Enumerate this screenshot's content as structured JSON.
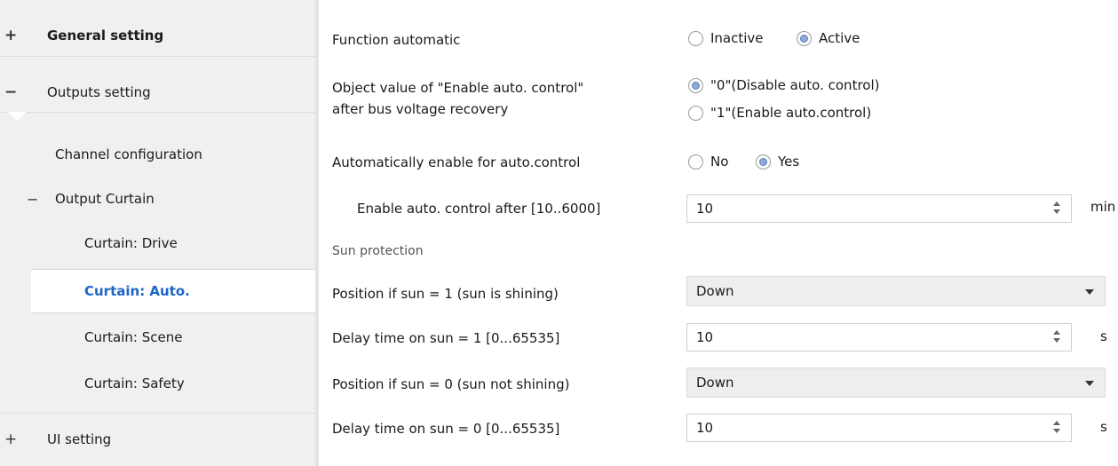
{
  "sidebar": {
    "general_setting": {
      "symbol": "+",
      "label": "General setting"
    },
    "outputs_setting": {
      "symbol": "−",
      "label": "Outputs setting"
    },
    "channel_configuration": {
      "label": "Channel configuration"
    },
    "output_curtain": {
      "symbol": "−",
      "label": "Output Curtain"
    },
    "curtain_drive": {
      "label": "Curtain: Drive"
    },
    "curtain_auto": {
      "label": "Curtain: Auto."
    },
    "curtain_scene": {
      "label": "Curtain: Scene"
    },
    "curtain_safety": {
      "label": "Curtain: Safety"
    },
    "ui_setting": {
      "symbol": "+",
      "label": "UI setting"
    }
  },
  "main": {
    "function_automatic": {
      "label": "Function automatic",
      "options": [
        "Inactive",
        "Active"
      ],
      "selected": "Active"
    },
    "enable_auto_control_value": {
      "label_line1": "Object value of \"Enable auto. control\"",
      "label_line2": "after bus voltage recovery",
      "options": [
        "\"0\"(Disable auto. control)",
        "\"1\"(Enable auto.control)"
      ],
      "selected": "\"0\"(Disable auto. control)"
    },
    "auto_enable": {
      "label": "Automatically enable for auto.control",
      "options": [
        "No",
        "Yes"
      ],
      "selected": "Yes"
    },
    "enable_after": {
      "label": "Enable auto. control after [10..6000]",
      "value": "10",
      "unit": "min"
    },
    "sun_protection": {
      "label": "Sun protection"
    },
    "position_sun_1": {
      "label": "Position if sun = 1  (sun is shining)",
      "value": "Down"
    },
    "delay_sun_1": {
      "label": "Delay time on sun = 1  [0...65535]",
      "value": "10",
      "unit": "s"
    },
    "position_sun_0": {
      "label": "Position if sun = 0  (sun not shining)",
      "value": "Down"
    },
    "delay_sun_0": {
      "label": "Delay time on sun = 0  [0...65535]",
      "value": "10",
      "unit": "s"
    }
  },
  "colors": {
    "active_item_text": "#1c66c8",
    "radio_selected": "#8ea9d6",
    "sidebar_bg": "#f0f0f0"
  }
}
